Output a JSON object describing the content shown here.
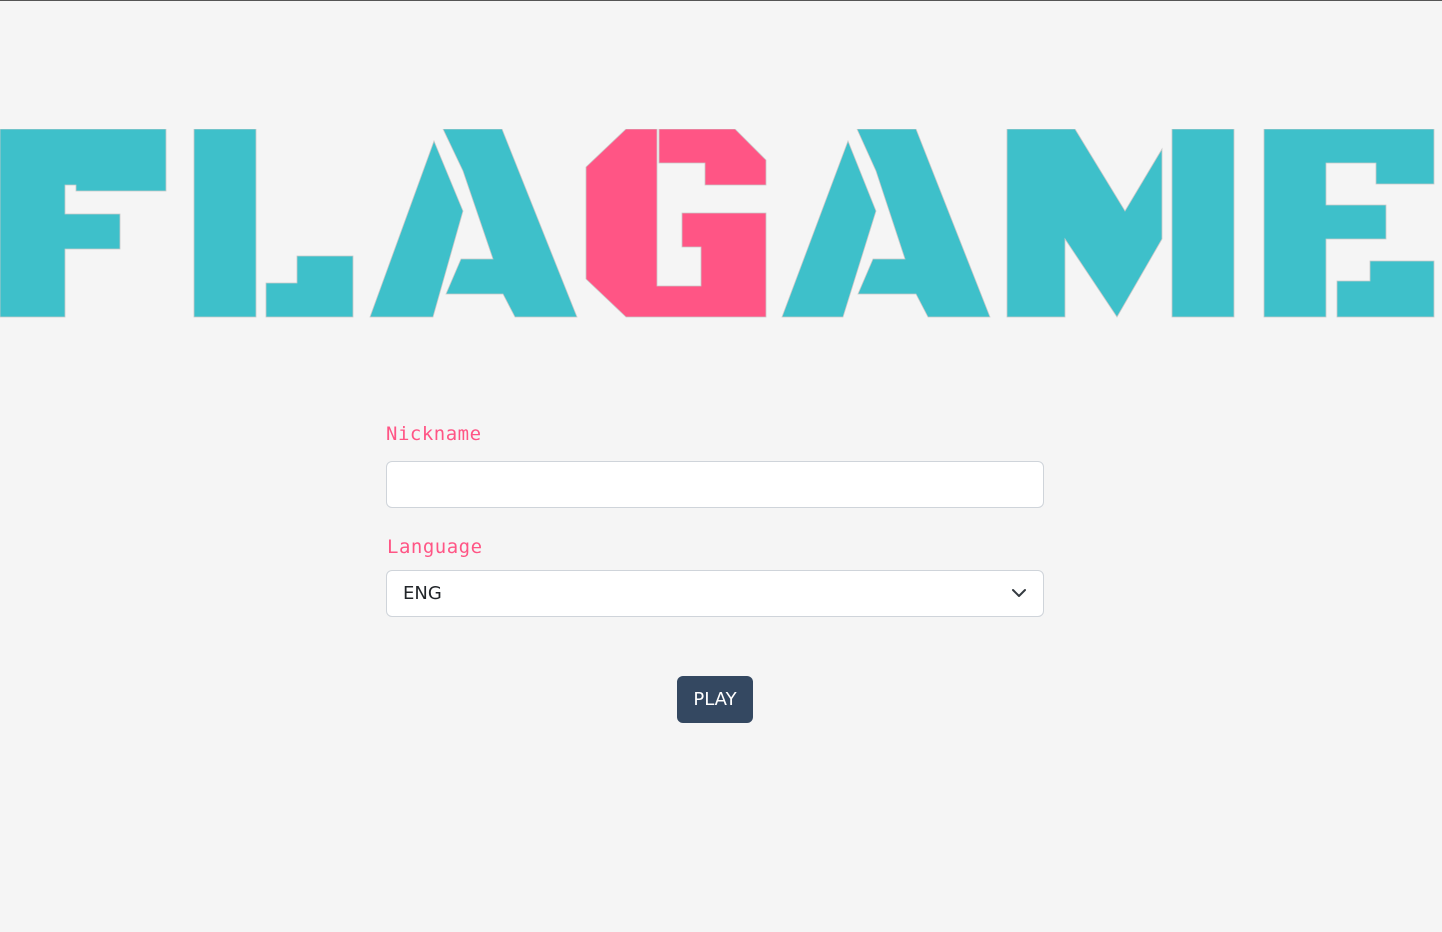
{
  "logo": {
    "text": "FLAGAME",
    "letters": [
      {
        "char": "F",
        "color": "#3ec0ca"
      },
      {
        "char": "L",
        "color": "#3ec0ca"
      },
      {
        "char": "A",
        "color": "#3ec0ca"
      },
      {
        "char": "G",
        "color": "#ff5585"
      },
      {
        "char": "A",
        "color": "#3ec0ca"
      },
      {
        "char": "M",
        "color": "#3ec0ca"
      },
      {
        "char": "E",
        "color": "#3ec0ca"
      }
    ]
  },
  "form": {
    "nickname_label": "Nickname",
    "nickname_value": "",
    "nickname_placeholder": "",
    "language_label": "Language",
    "language_value": "ENG",
    "play_label": "PLAY"
  },
  "colors": {
    "accent": "#ff5585",
    "logo_primary": "#3ec0ca",
    "button": "#344861",
    "background": "#f5f5f5"
  },
  "icons": {
    "select_arrow": "chevron-down-icon"
  }
}
